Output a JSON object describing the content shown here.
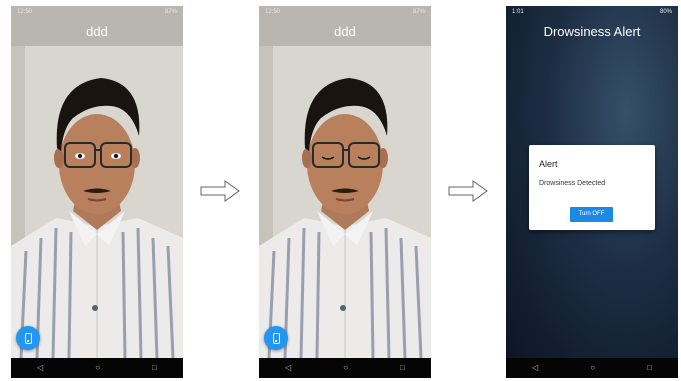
{
  "phone1": {
    "status_time": "12:50",
    "status_right": "87%",
    "title": "ddd"
  },
  "phone2": {
    "status_time": "12:50",
    "status_right": "87%",
    "title": "ddd"
  },
  "phone3": {
    "status_time": "1:01",
    "status_right": "80%",
    "title": "Drowsiness Alert",
    "dialog": {
      "title": "Alert",
      "message": "Drowsiness Detected",
      "button_label": "Turn OFF"
    }
  },
  "nav_icons": [
    "back-icon",
    "home-icon",
    "recents-icon"
  ],
  "fab_icon": "phone-icon",
  "colors": {
    "fab": "#2196f3",
    "dialog_button": "#1e88e5",
    "alert_background": "#1d2e44"
  }
}
